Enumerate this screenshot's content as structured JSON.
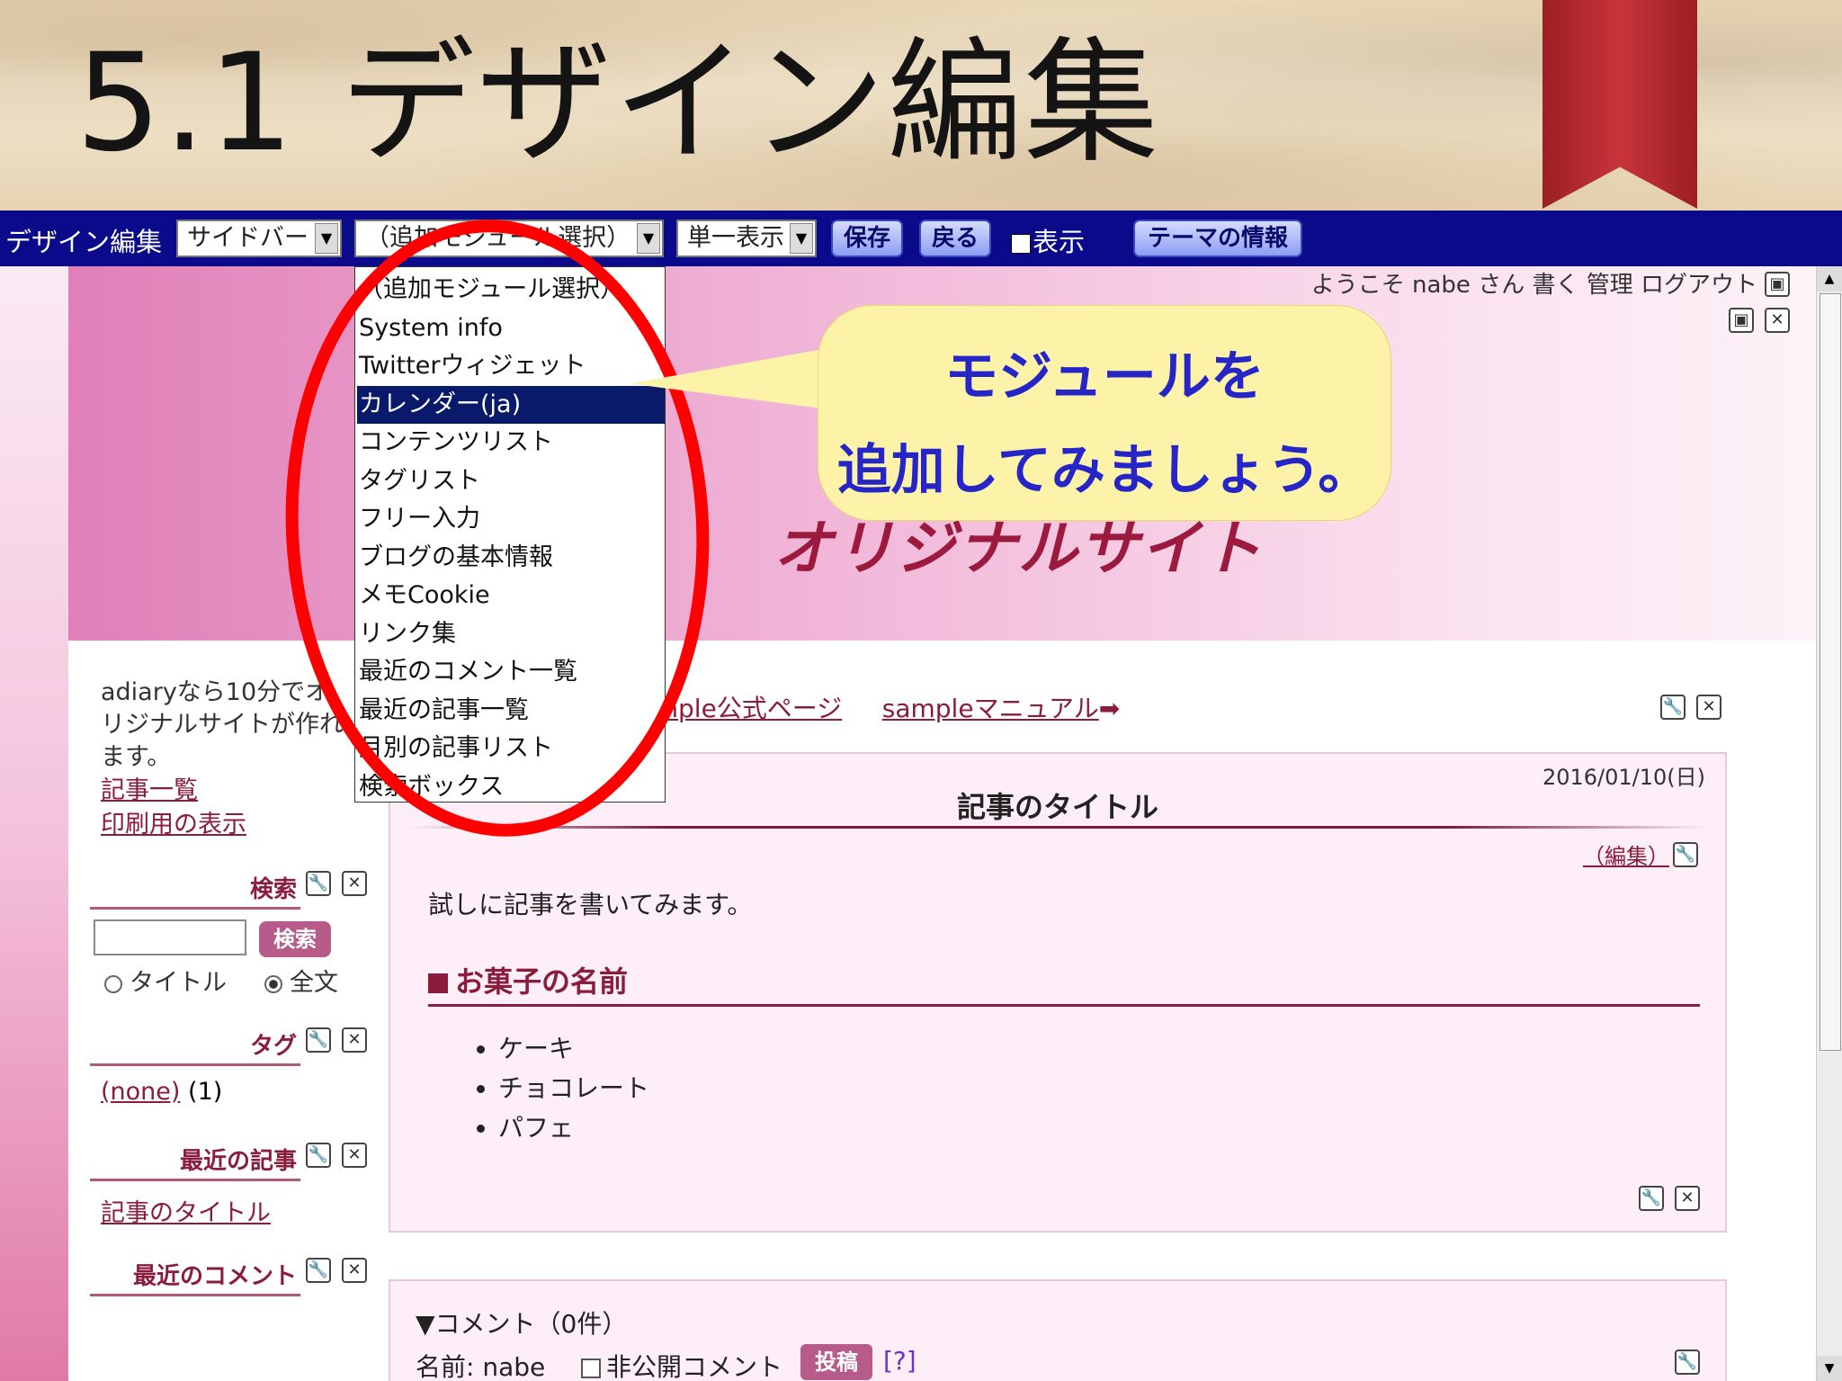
{
  "slide": {
    "title": "5.1 デザイン編集"
  },
  "toolbar": {
    "label": "デザイン編集",
    "area_select": "サイドバー",
    "module_select": "（追加モジュール選択）",
    "view_select": "単一表示",
    "save_label": "保存",
    "back_label": "戻る",
    "show_label": "表示",
    "theme_info_label": "テーマの情報"
  },
  "dropdown": {
    "items": [
      "（追加モジュール選択）",
      "System info",
      "Twitterウィジェット",
      "カレンダー(ja)",
      "コンテンツリスト",
      "タグリスト",
      "フリー入力",
      "ブログの基本情報",
      "メモCookie",
      "リンク集",
      "最近のコメント一覧",
      "最近の記事一覧",
      "月別の記事リスト",
      "検索ボックス"
    ],
    "selected_index": 3
  },
  "callout": {
    "line1": "モジュールを",
    "line2": "追加してみましょう。"
  },
  "header": {
    "welcome": "ようこそ nabe さん 書く 管理 ログアウト",
    "site_name": "オリジナルサイト"
  },
  "sidebar": {
    "intro": "adiaryなら10分でオリジナルサイトが作れます。",
    "links": [
      "記事一覧",
      "印刷用の表示"
    ],
    "search": {
      "heading": "検索",
      "button": "検索",
      "radio_title": "タイトル",
      "radio_full": "全文",
      "selected": "全文"
    },
    "tags": {
      "heading": "タグ",
      "tag": "(none)",
      "count": "(1)"
    },
    "recent_posts": {
      "heading": "最近の記事",
      "item": "記事のタイトル"
    },
    "recent_comments": {
      "heading": "最近のコメント"
    }
  },
  "main": {
    "top_links": [
      "sample公式ページ",
      "sampleマニュアル"
    ],
    "article": {
      "date": "2016/01/10(日)",
      "title": "記事のタイトル",
      "edit": "（編集）",
      "body": "試しに記事を書いてみます。",
      "heading": "お菓子の名前",
      "items": [
        "ケーキ",
        "チョコレート",
        "パフェ"
      ]
    },
    "comments": {
      "heading": "▼コメント（0件）",
      "name": "名前: nabe",
      "private": "非公開コメント",
      "post": "投稿",
      "help": "[?]"
    }
  },
  "colors": {
    "toolbar_bg": "#0a0a8a",
    "annotation_red": "#ff0000",
    "callout_bg": "#fdf3a8",
    "callout_text": "#2626c8",
    "accent": "#8a1c3c"
  }
}
